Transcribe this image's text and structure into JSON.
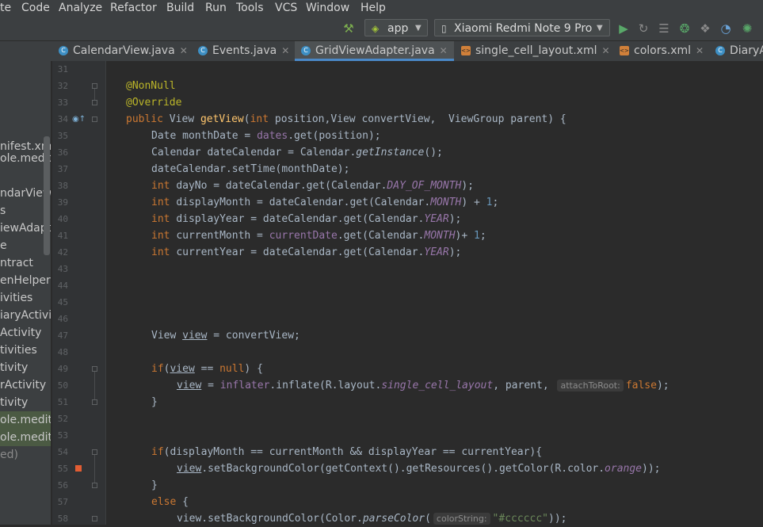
{
  "menu": [
    "te",
    "Code",
    "Analyze",
    "Refactor",
    "Build",
    "Run",
    "Tools",
    "VCS",
    "Window",
    "Help"
  ],
  "toolbar": {
    "config": "app",
    "device": "Xiaomi Redmi Note 9 Pro"
  },
  "tabs": [
    "CalendarView.java",
    "Events.java",
    "GridViewAdapter.java",
    "single_cell_layout.xml",
    "colors.xml",
    "DiaryA"
  ],
  "active_tab": 2,
  "tree": [
    "nifest.xm",
    "ole.medita",
    "ndarView",
    "s",
    "iewAdapt",
    "e",
    "ntract",
    "enHelper",
    "ivities",
    "iaryActivi",
    "Activity",
    "tivities",
    "tivity",
    "rActivity",
    "tivity",
    "ole.medita",
    "ole.medita",
    "ed)"
  ],
  "line_numbers": [
    "31",
    "32",
    "33",
    "34",
    "35",
    "36",
    "37",
    "38",
    "39",
    "40",
    "41",
    "42",
    "43",
    "44",
    "45",
    "46",
    "47",
    "48",
    "49",
    "50",
    "51",
    "52",
    "53",
    "54",
    "55",
    "56",
    "57",
    "58"
  ],
  "code": {
    "l32": "@NonNull",
    "l33": "@Override",
    "l34": [
      "public ",
      "View ",
      "getView",
      "(",
      "int ",
      "position,View convertView,  ViewGroup parent) {"
    ],
    "l35": [
      "Date monthDate = ",
      "dates",
      ".get(position);"
    ],
    "l36": [
      "Calendar dateCalendar = Calendar.",
      "getInstance",
      "();"
    ],
    "l37": "dateCalendar.setTime(monthDate);",
    "l38": [
      "int ",
      "dayNo = dateCalendar.get(Calendar.",
      "DAY_OF_MONTH",
      ");"
    ],
    "l39": [
      "int ",
      "displayMonth = dateCalendar.get(Calendar.",
      "MONTH",
      ") + ",
      "1",
      ";"
    ],
    "l40": [
      "int ",
      "displayYear = dateCalendar.get(Calendar.",
      "YEAR",
      ");"
    ],
    "l41": [
      "int ",
      "currentMonth = ",
      "currentDate",
      ".get(Calendar.",
      "MONTH",
      ")+ ",
      "1",
      ";"
    ],
    "l42": [
      "int ",
      "currentYear = dateCalendar.get(Calendar.",
      "YEAR",
      ");"
    ],
    "l47": [
      "View ",
      "view",
      " = convertView;"
    ],
    "l49": [
      "if",
      "(",
      "view",
      " == ",
      "null",
      ") {"
    ],
    "l50": [
      "view",
      " = ",
      "inflater",
      ".inflate(R.layout.",
      "single_cell_layout",
      ", parent, ",
      "attachToRoot:",
      "false",
      ");"
    ],
    "l51": "}",
    "l54": [
      "if",
      "(displayMonth == currentMonth && displayYear == currentYear){"
    ],
    "l55": [
      "view",
      ".setBackgroundColor(getContext().getResources().getColor(R.color.",
      "orange",
      "));"
    ],
    "l56": "}",
    "l57": [
      "else ",
      "{"
    ],
    "l58": [
      "view.setBackgroundColor(Color.",
      "parseColor",
      "(",
      "colorString:",
      "\"#cccccc\"",
      "));"
    ]
  },
  "colors": {
    "keyword": "#cc7832",
    "annotation": "#bbb529",
    "method": "#ffc66d",
    "field": "#9876aa",
    "number": "#6897bb",
    "string": "#6a8759",
    "text": "#a9b7c6"
  },
  "icons": [
    "android-icon",
    "phone-icon",
    "hammer-icon",
    "run-icon",
    "rerun-icon",
    "logcat-icon",
    "debug-icon",
    "attach-debugger-icon",
    "profiler-icon",
    "apply-changes-icon",
    "gear-icon",
    "minimize-icon"
  ]
}
